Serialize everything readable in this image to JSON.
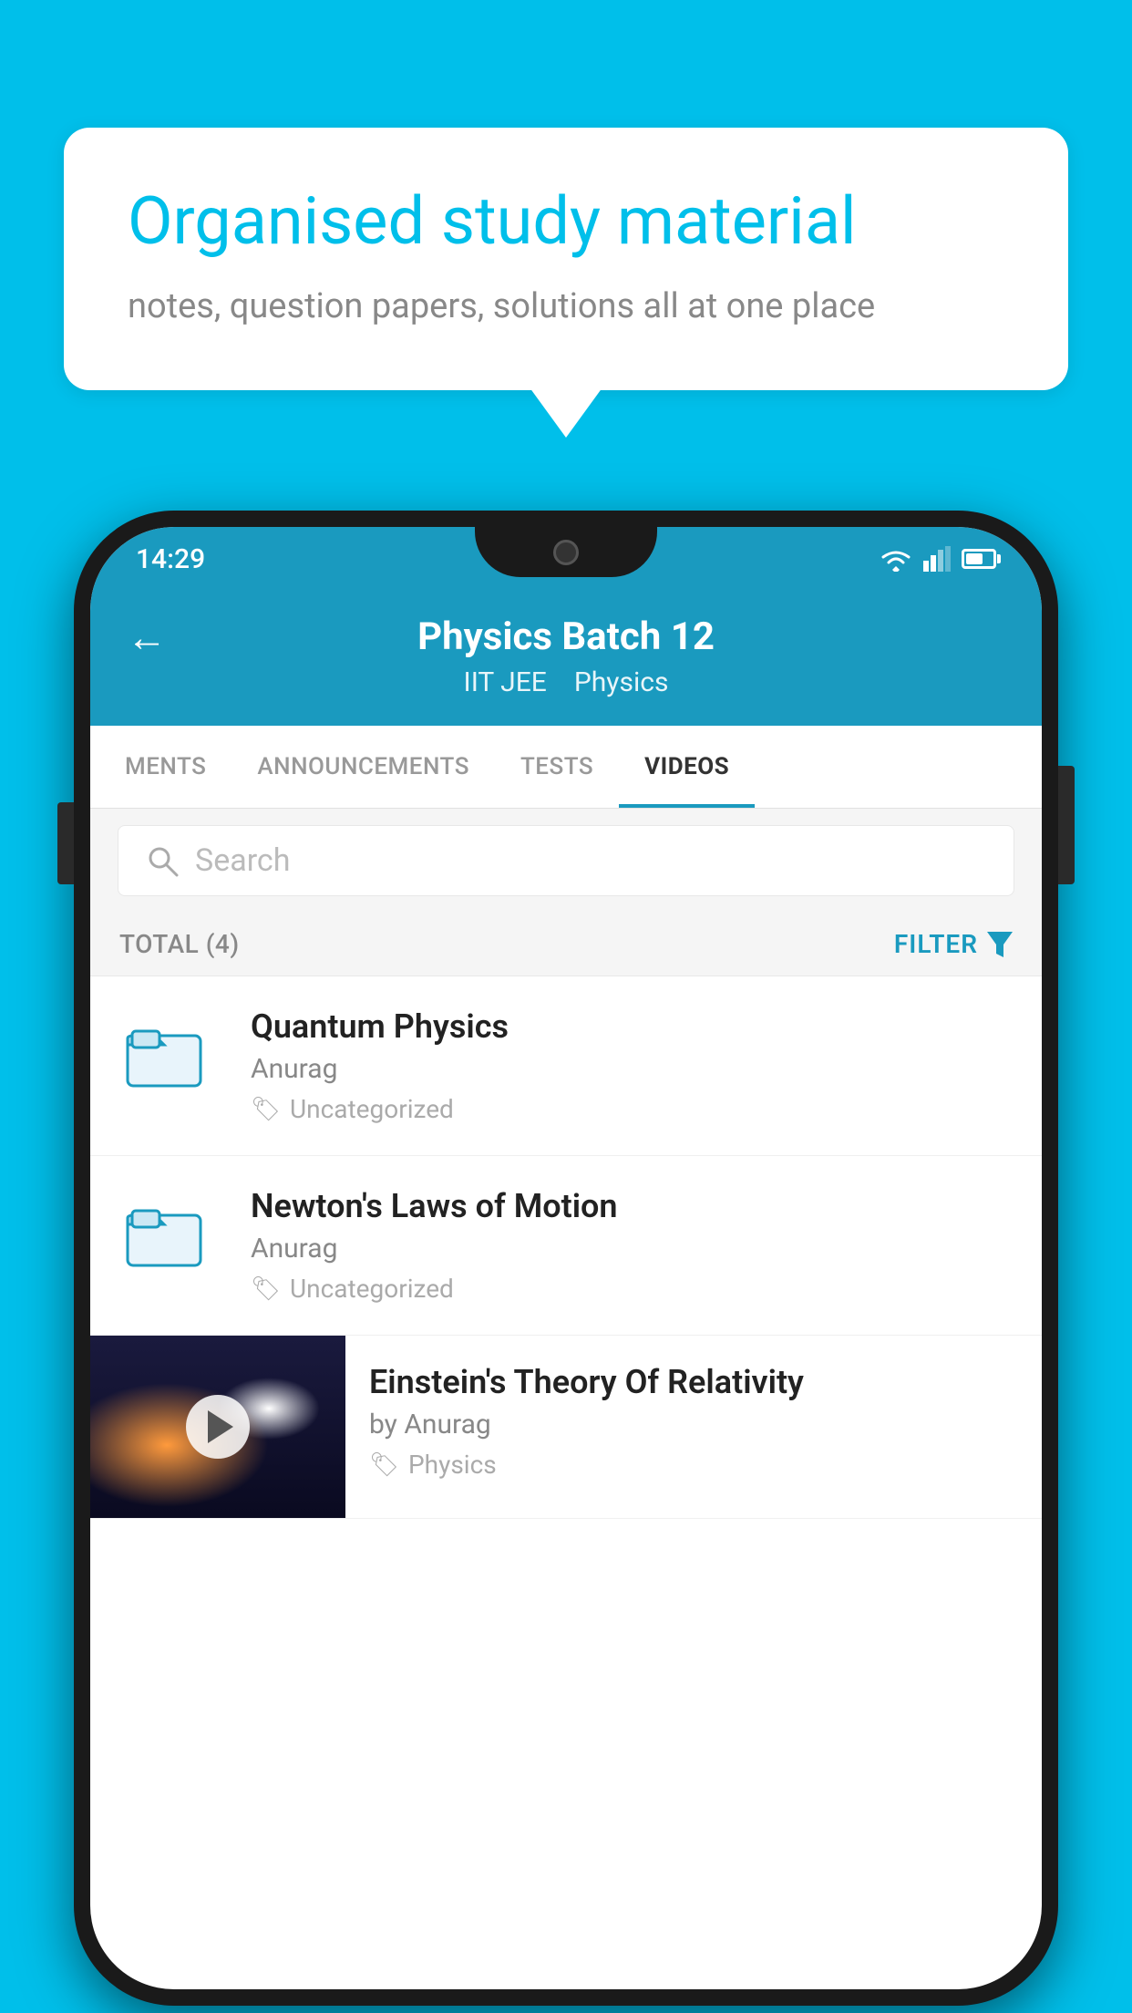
{
  "background_color": "#00BFEA",
  "speech_bubble": {
    "title": "Organised study material",
    "subtitle": "notes, question papers, solutions all at one place"
  },
  "phone": {
    "status_bar": {
      "time": "14:29"
    },
    "app_bar": {
      "back_label": "←",
      "title": "Physics Batch 12",
      "tags": [
        "IIT JEE",
        "Physics"
      ]
    },
    "tabs": [
      {
        "label": "MENTS",
        "active": false
      },
      {
        "label": "ANNOUNCEMENTS",
        "active": false
      },
      {
        "label": "TESTS",
        "active": false
      },
      {
        "label": "VIDEOS",
        "active": true
      }
    ],
    "search": {
      "placeholder": "Search"
    },
    "filter": {
      "total_label": "TOTAL (4)",
      "filter_label": "FILTER"
    },
    "videos": [
      {
        "id": 1,
        "title": "Quantum Physics",
        "author": "Anurag",
        "tag": "Uncategorized",
        "type": "folder"
      },
      {
        "id": 2,
        "title": "Newton's Laws of Motion",
        "author": "Anurag",
        "tag": "Uncategorized",
        "type": "folder"
      },
      {
        "id": 3,
        "title": "Einstein's Theory Of Relativity",
        "author": "by Anurag",
        "tag": "Physics",
        "type": "video"
      }
    ]
  }
}
